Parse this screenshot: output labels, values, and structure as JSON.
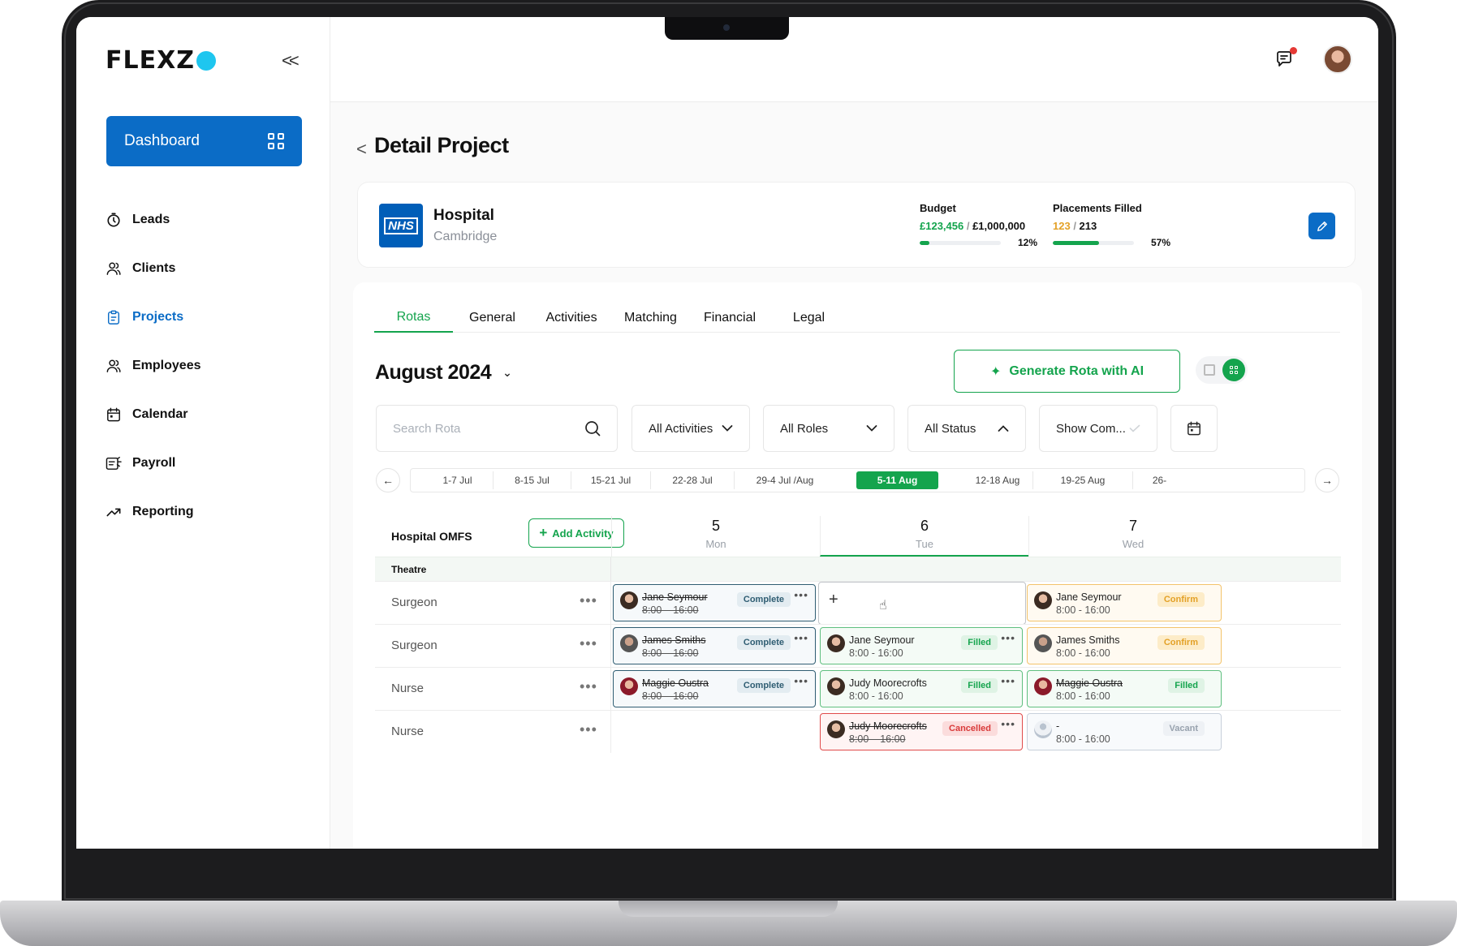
{
  "brand": {
    "name": "FLEXZ",
    "collapse": "<<"
  },
  "sidebar": {
    "dashboard_label": "Dashboard",
    "items": [
      {
        "label": "Leads",
        "icon": "timer-icon"
      },
      {
        "label": "Clients",
        "icon": "users-icon"
      },
      {
        "label": "Projects",
        "icon": "clipboard-icon",
        "active": true
      },
      {
        "label": "Employees",
        "icon": "users-icon"
      },
      {
        "label": "Calendar",
        "icon": "calendar-icon"
      },
      {
        "label": "Payroll",
        "icon": "payroll-icon"
      },
      {
        "label": "Reporting",
        "icon": "trend-icon"
      }
    ]
  },
  "header": {
    "back": "<",
    "title": "Detail Project"
  },
  "project": {
    "logo_text": "NHS",
    "name": "Hospital",
    "location": "Cambridge",
    "budget": {
      "label": "Budget",
      "spent": "£123,456",
      "separator": " / ",
      "total": "£1,000,000",
      "percent_label": "12%",
      "fraction": 0.12
    },
    "placements": {
      "label": "Placements Filled",
      "filled": "123",
      "separator": " / ",
      "total": "213",
      "percent_label": "57%",
      "fraction": 0.57
    }
  },
  "tabs": [
    "Rotas",
    "General",
    "Activities",
    "Matching",
    "Financial",
    "Legal"
  ],
  "rota": {
    "month": "August 2024",
    "generate_label": "Generate Rota with AI",
    "filters": {
      "search_placeholder": "Search Rota",
      "activities": "All Activities",
      "roles": "All Roles",
      "status": "All Status",
      "show": "Show Com..."
    },
    "weeks": [
      "1-7 Jul",
      "8-15 Jul",
      "15-21 Jul",
      "22-28 Jul",
      "29-4 Jul /Aug",
      "5-11 Aug",
      "12-18 Aug",
      "19-25 Aug",
      "26-"
    ],
    "active_week": "5-11 Aug",
    "activity_title": "Hospital OMFS",
    "add_activity_label": "Add Activity",
    "days": [
      {
        "num": "5",
        "name": "Mon"
      },
      {
        "num": "6",
        "name": "Tue"
      },
      {
        "num": "7",
        "name": "Wed"
      }
    ],
    "group": "Theatre",
    "rows": [
      {
        "role": "Surgeon",
        "dots": "•••",
        "mon": {
          "name": "Jane Seymour",
          "time": "8:00 – 16:00",
          "status": "Complete"
        },
        "tue_add": "+",
        "wed": {
          "name": "Jane Seymour",
          "time": "8:00 - 16:00",
          "status": "Confirm"
        }
      },
      {
        "role": "Surgeon",
        "dots": "•••",
        "mon": {
          "name": "James Smiths",
          "time": "8:00 – 16:00",
          "status": "Complete"
        },
        "tue": {
          "name": "Jane Seymour",
          "time": "8:00 - 16:00",
          "status": "Filled"
        },
        "wed": {
          "name": "James Smiths",
          "time": "8:00 - 16:00",
          "status": "Confirm"
        }
      },
      {
        "role": "Nurse",
        "dots": "•••",
        "mon": {
          "name": "Maggie Oustra",
          "time": "8:00 – 16:00",
          "status": "Complete"
        },
        "tue": {
          "name": "Judy Moorecrofts",
          "time": "8:00 - 16:00",
          "status": "Filled"
        },
        "wed": {
          "name": "Maggie Oustra",
          "time": "8:00 - 16:00",
          "status": "Filled"
        }
      },
      {
        "role": "Nurse",
        "dots": "•••",
        "tue": {
          "name": "Judy Moorecrofts",
          "time": "8:00 – 16:00",
          "status": "Cancelled"
        },
        "wed": {
          "name": "-",
          "time": "8:00 - 16:00",
          "status": "Vacant"
        }
      }
    ],
    "more": "•••"
  },
  "colors": {
    "primary": "#0b6cc6",
    "accent": "#14a44d",
    "logo_dot": "#1ec6ef"
  }
}
